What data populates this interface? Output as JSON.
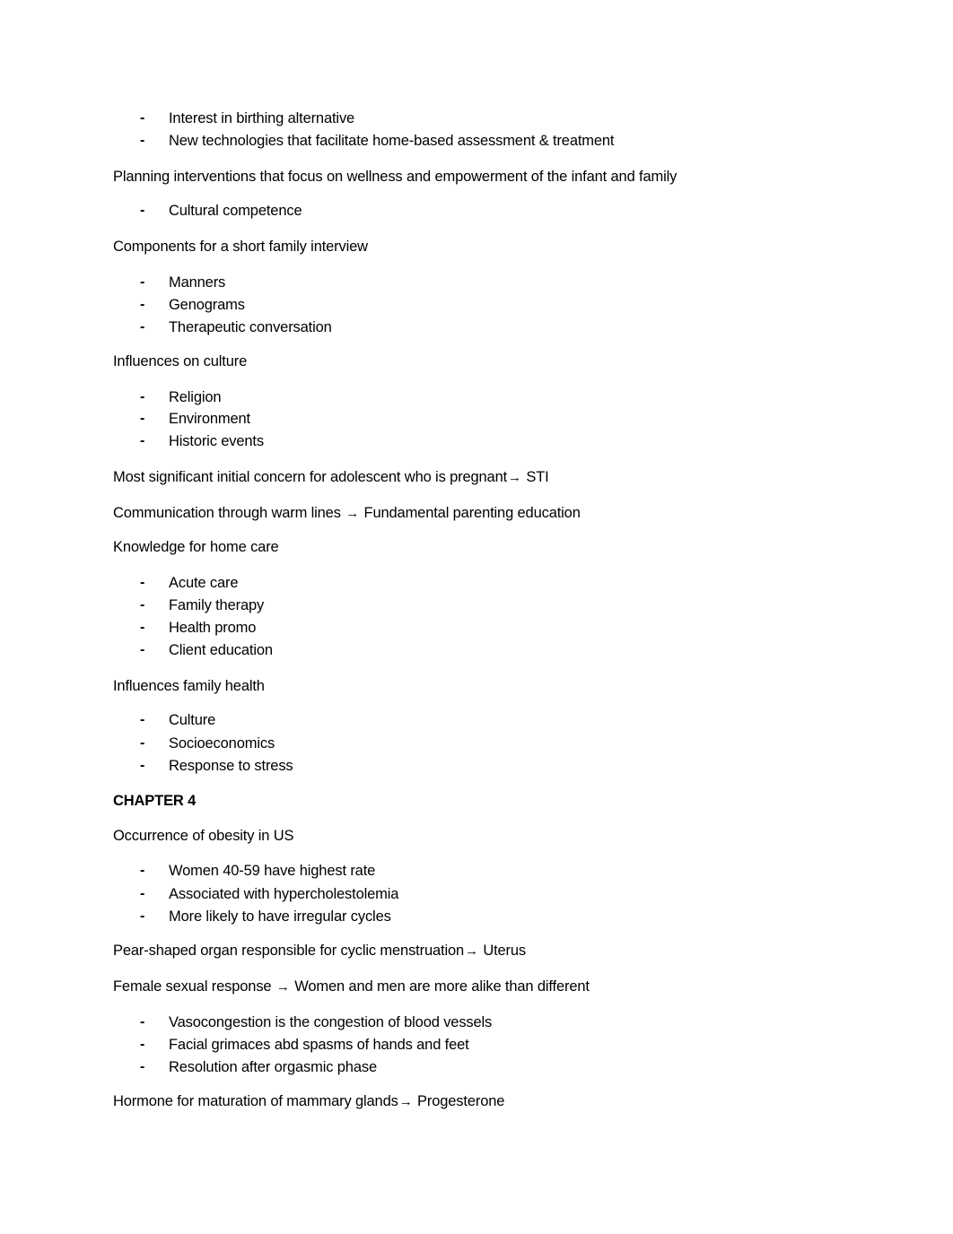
{
  "document": {
    "blocks": [
      {
        "type": "bullet",
        "text": "Interest in birthing alternative"
      },
      {
        "type": "bullet",
        "text": "New technologies that facilitate home-based assessment & treatment"
      },
      {
        "type": "paragraph",
        "text": "Planning interventions that focus on wellness and empowerment of the infant and family"
      },
      {
        "type": "bullet",
        "text": "Cultural competence"
      },
      {
        "type": "paragraph",
        "text": "Components for a short family interview"
      },
      {
        "type": "bullet",
        "text": "Manners"
      },
      {
        "type": "bullet",
        "text": "Genograms"
      },
      {
        "type": "bullet",
        "text": "Therapeutic conversation"
      },
      {
        "type": "paragraph",
        "text": "Influences on culture"
      },
      {
        "type": "bullet",
        "text": "Religion"
      },
      {
        "type": "bullet",
        "text": "Environment"
      },
      {
        "type": "bullet",
        "text": "Historic events"
      },
      {
        "type": "arrow-paragraph",
        "left": "Most significant initial concern for adolescent who is pregnant",
        "right": "STI"
      },
      {
        "type": "arrow-paragraph",
        "left": "Communication through warm lines ",
        "right": "Fundamental parenting education"
      },
      {
        "type": "paragraph",
        "text": "Knowledge for home care"
      },
      {
        "type": "bullet",
        "text": "Acute care"
      },
      {
        "type": "bullet",
        "text": "Family therapy"
      },
      {
        "type": "bullet",
        "text": "Health promo"
      },
      {
        "type": "bullet",
        "text": "Client education"
      },
      {
        "type": "paragraph",
        "text": "Influences family health"
      },
      {
        "type": "bullet",
        "text": "Culture"
      },
      {
        "type": "bullet",
        "text": "Socioeconomics"
      },
      {
        "type": "bullet",
        "text": "Response to stress"
      },
      {
        "type": "heading",
        "text": "CHAPTER 4"
      },
      {
        "type": "paragraph",
        "text": "Occurrence of obesity in US"
      },
      {
        "type": "bullet",
        "text": "Women 40-59 have highest rate"
      },
      {
        "type": "bullet",
        "text": "Associated with hypercholestolemia"
      },
      {
        "type": "bullet",
        "text": "More likely to have irregular cycles"
      },
      {
        "type": "arrow-paragraph",
        "left": "Pear-shaped organ responsible for cyclic menstruation",
        "right": "Uterus"
      },
      {
        "type": "arrow-paragraph",
        "left": "Female sexual response ",
        "right": "Women and men are more alike than different"
      },
      {
        "type": "bullet",
        "text": "Vasocongestion is the congestion of blood vessels"
      },
      {
        "type": "bullet",
        "text": "Facial grimaces abd spasms of hands and feet"
      },
      {
        "type": "bullet",
        "text": "Resolution after orgasmic phase"
      },
      {
        "type": "arrow-paragraph",
        "left": "Hormone for maturation of mammary glands",
        "right": "Progesterone"
      }
    ],
    "bullet_marker": "-",
    "arrow_glyph": "→"
  }
}
